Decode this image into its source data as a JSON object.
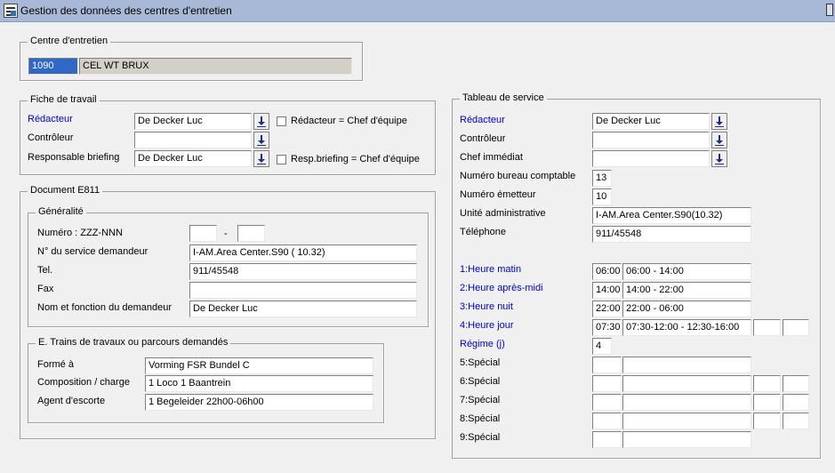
{
  "window": {
    "title": "Gestion des données des centres d'entretien"
  },
  "centre": {
    "legend": "Centre d'entretien",
    "code": "1090",
    "name": "CEL WT BRUX"
  },
  "fiche": {
    "legend": "Fiche de travail",
    "redacteur_label": "Rédacteur",
    "redacteur_value": "De Decker Luc",
    "redacteur_chk_label": "Rédacteur = Chef d'équipe",
    "controleur_label": "Contrôleur",
    "controleur_value": "",
    "resp_label": "Responsable briefing",
    "resp_value": "De Decker Luc",
    "resp_chk_label": "Resp.briefing = Chef d'équipe"
  },
  "document": {
    "legend": "Document E811",
    "generalite": {
      "legend": "Généralité",
      "numero_label": "Numéro : ZZZ-NNN",
      "numero_part1": "",
      "numero_sep": "-",
      "numero_part2": "",
      "service_label": "N° du service demandeur",
      "service_value": "I-AM.Area Center.S90 ( 10.32)",
      "tel_label": "Tel.",
      "tel_value": "911/45548",
      "fax_label": "Fax",
      "fax_value": "",
      "nom_label": "Nom et fonction du demandeur",
      "nom_value": "De Decker Luc"
    },
    "trains": {
      "legend": "E. Trains de travaux ou parcours demandés",
      "forme_label": "Formé à",
      "forme_value": "Vorming FSR Bundel C",
      "compo_label": "Composition / charge",
      "compo_value": "1  Loco 1 Baantrein",
      "agent_label": "Agent d'escorte",
      "agent_value": "1 Begeleider 22h00-06h00"
    }
  },
  "tableau": {
    "legend": "Tableau de service",
    "redacteur_label": "Rédacteur",
    "redacteur_value": "De Decker Luc",
    "controleur_label": "Contrôleur",
    "controleur_value": "",
    "chef_label": "Chef immédiat",
    "chef_value": "",
    "bureau_label": "Numéro bureau comptable",
    "bureau_value": "13",
    "emetteur_label": "Numéro émetteur",
    "emetteur_value": "10",
    "unite_label": "Unité administrative",
    "unite_value": "I-AM.Area Center.S90(10.32)",
    "tel_label": "Téléphone",
    "tel_value": "911/45548",
    "heures": [
      {
        "label": "1:Heure matin",
        "code": "06:00",
        "value": "06:00 - 14:00"
      },
      {
        "label": "2:Heure après-midi",
        "code": "14:00",
        "value": "14:00 - 22:00"
      },
      {
        "label": "3:Heure nuit",
        "code": "22:00",
        "value": "22:00 - 06:00"
      },
      {
        "label": "4:Heure jour",
        "code": "07:30",
        "value": "07:30-12:00 - 12:30-16:00"
      }
    ],
    "regime_label": "Régime (j)",
    "regime_value": "4",
    "speciaux": [
      {
        "label": "5:Spécial"
      },
      {
        "label": "6:Spécial"
      },
      {
        "label": "7:Spécial"
      },
      {
        "label": "8:Spécial"
      },
      {
        "label": "9:Spécial"
      }
    ]
  },
  "icons": {
    "lookup": "download-arrow-icon",
    "app": "form-window-icon"
  },
  "colors": {
    "label_blue": "#0000cc",
    "titlebar": "#a7b9d6",
    "selection": "#3168c6"
  }
}
